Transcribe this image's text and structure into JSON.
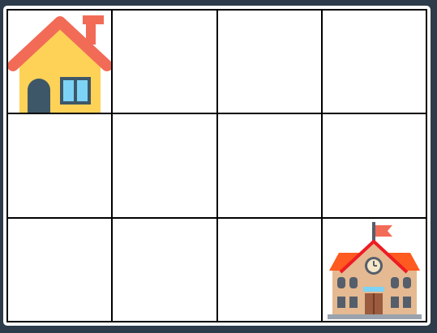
{
  "grid": {
    "rows": 3,
    "cols": 4,
    "background_color": "#2d3b4a",
    "line_color": "#000000"
  },
  "pieces": [
    {
      "name": "house-icon",
      "row": 0,
      "col": 0
    },
    {
      "name": "school-icon",
      "row": 2,
      "col": 3
    }
  ]
}
